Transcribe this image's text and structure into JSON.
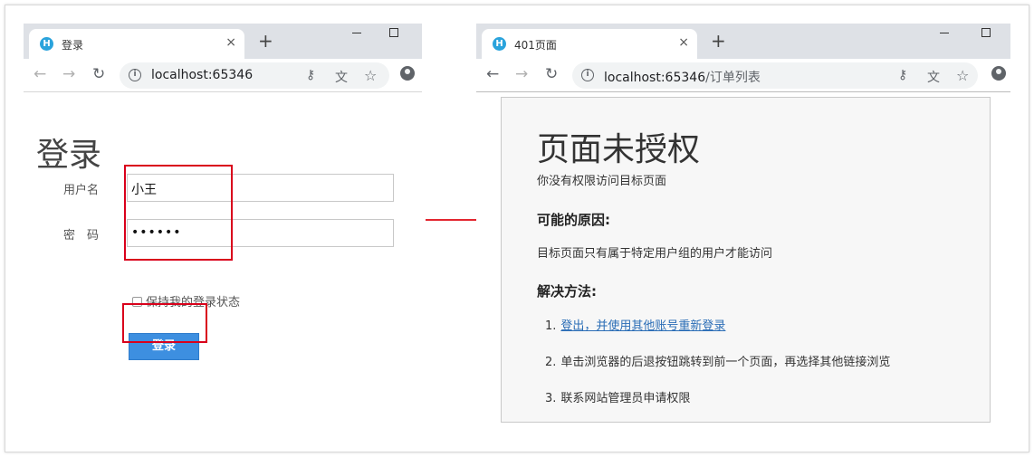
{
  "left_browser": {
    "tab_title": "登录",
    "tab_close": "×",
    "new_tab": "+",
    "url_host": "localhost:65346",
    "url_path": "",
    "page": {
      "title": "登录",
      "username_label": "用户名",
      "username_value": "小王",
      "password_label": "密　码",
      "password_value": "••••••",
      "remember_label": "保持我的登录状态",
      "login_button": "登录"
    }
  },
  "right_browser": {
    "tab_title": "401页面",
    "tab_close": "×",
    "new_tab": "+",
    "url_host": "localhost:65346",
    "url_path": "/订单列表",
    "page": {
      "title": "页面未授权",
      "subtitle": "你没有权限访问目标页面",
      "reason_heading": "可能的原因:",
      "reason_text": "目标页面只有属于特定用户组的用户才能访问",
      "solution_heading": "解决方法:",
      "solutions": [
        {
          "num": "1.",
          "text": "登出，并使用其他账号重新登录"
        },
        {
          "num": "2.",
          "text": "单击浏览器的后退按钮跳转到前一个页面，再选择其他链接浏览"
        },
        {
          "num": "3.",
          "text": "联系网站管理员申请权限"
        }
      ]
    }
  },
  "icons": {
    "back": "←",
    "forward": "→",
    "reload": "↻",
    "key": "⚷",
    "translate": "文",
    "star": "☆",
    "favicon": "H",
    "info": "i"
  },
  "colors": {
    "highlight_red": "#d9001b",
    "arrow_red": "#e3262f",
    "login_button_blue": "#3d8fe0",
    "link_blue": "#2a6db6",
    "favicon_blue": "#2aa3dc"
  }
}
